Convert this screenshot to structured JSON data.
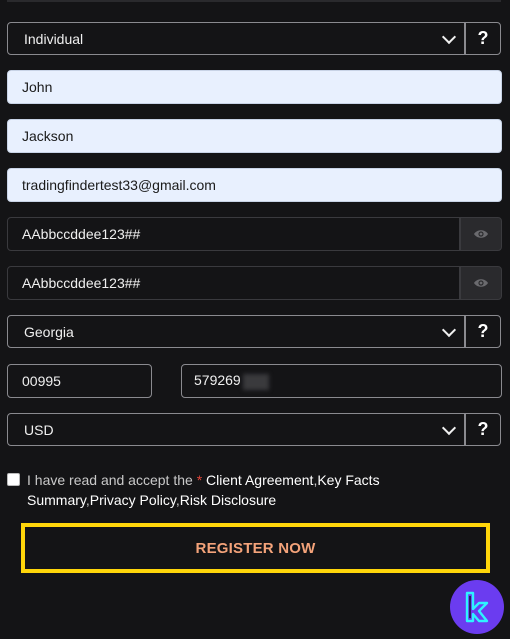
{
  "form": {
    "account_type": {
      "value": "Individual",
      "help_label": "?"
    },
    "first_name": {
      "value": "John"
    },
    "last_name": {
      "value": "Jackson"
    },
    "email": {
      "value": "tradingfindertest33@gmail.com"
    },
    "password": {
      "value": "AAbbccddee123##"
    },
    "confirm_password": {
      "value": "AAbbccddee123##"
    },
    "country": {
      "value": "Georgia",
      "help_label": "?"
    },
    "phone_code": {
      "value": "00995"
    },
    "phone_number": {
      "value": "579269"
    },
    "currency": {
      "value": "USD",
      "help_label": "?"
    }
  },
  "agreement": {
    "prefix": "I have read and accept the ",
    "required_mark": "*",
    "link1": "Client Agreement",
    "sep1": ",",
    "link2": "Key Facts Summary",
    "sep2": ",",
    "link3": "Privacy Policy",
    "sep3": ",",
    "link4": "Risk Disclosure"
  },
  "register_button": {
    "label": "REGISTER NOW"
  },
  "colors": {
    "accent_border": "#ffd60a",
    "button_text": "#f4a37a",
    "logo_bg": "#6b3cf0"
  }
}
